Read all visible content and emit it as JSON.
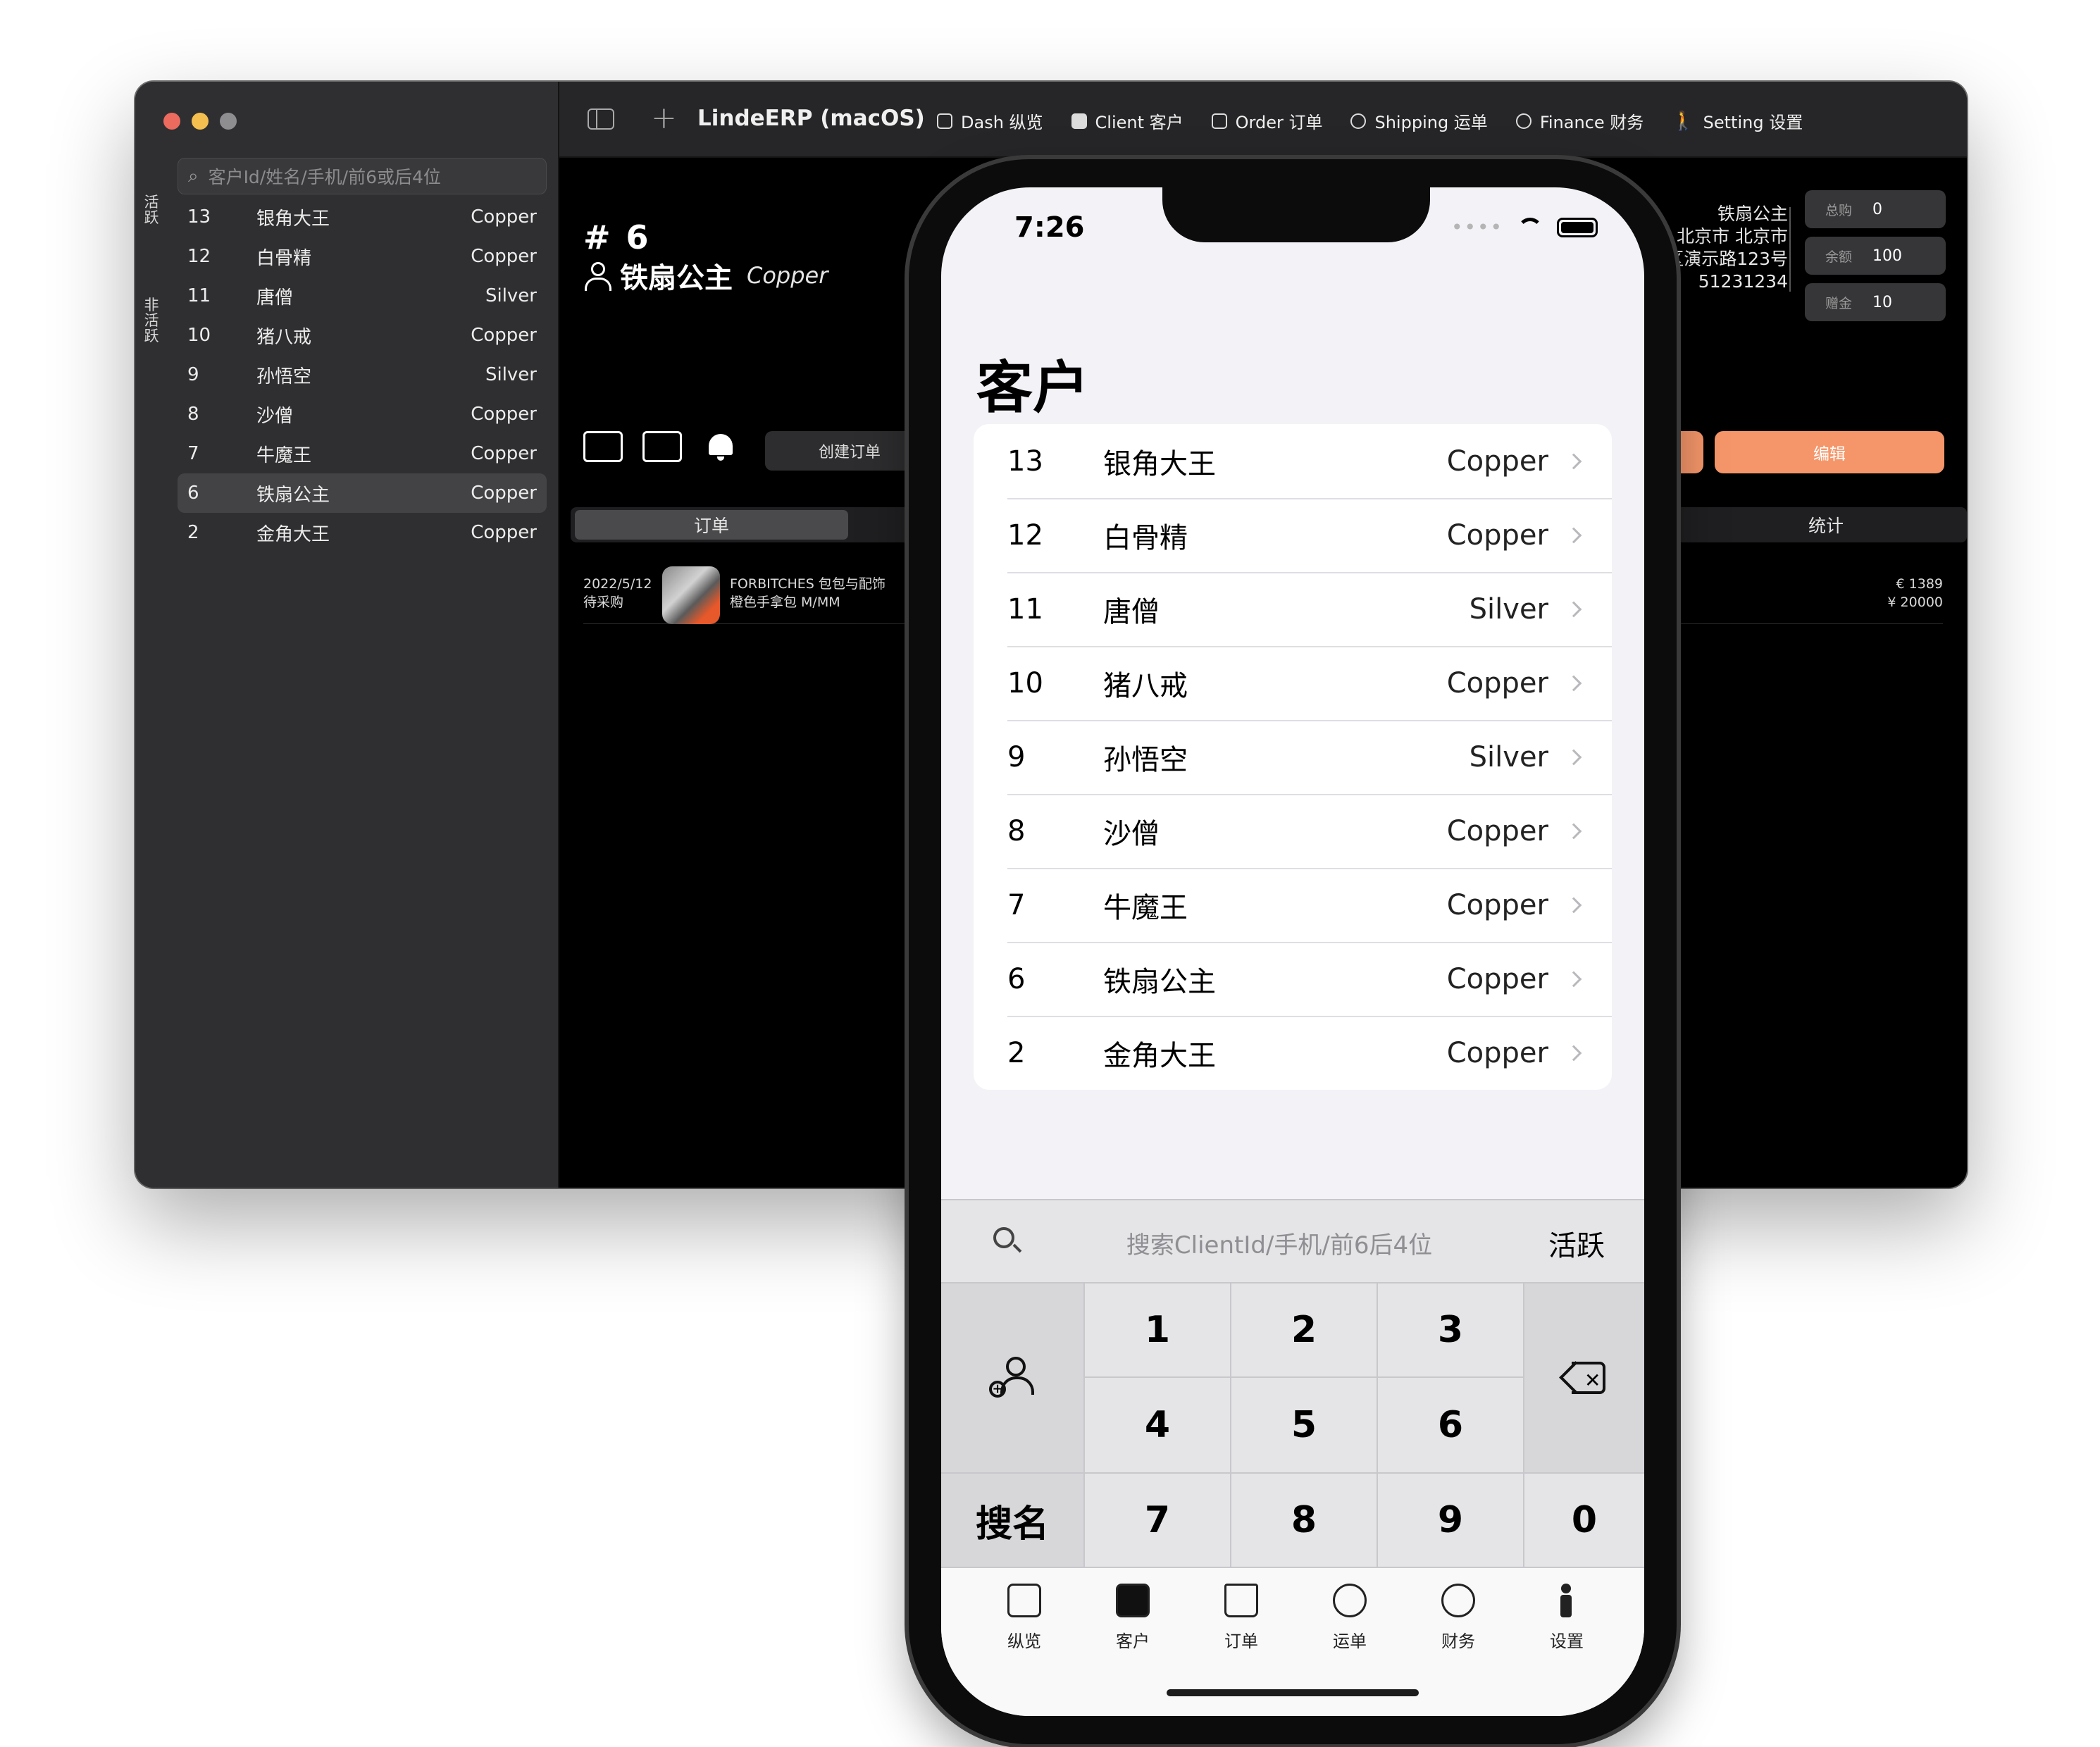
{
  "mac": {
    "title": "LindeERP (macOS)",
    "nav": [
      {
        "label": "Dash 纵览",
        "icon": "dashboard-icon"
      },
      {
        "label": "Client 客户",
        "icon": "client-card-icon"
      },
      {
        "label": "Order 订单",
        "icon": "bag-icon"
      },
      {
        "label": "Shipping 运单",
        "icon": "globe-icon"
      },
      {
        "label": "Finance 财务",
        "icon": "dollar-icon"
      },
      {
        "label": "Setting 设置",
        "icon": "person-standing-icon"
      }
    ],
    "search_placeholder": "客户Id/姓名/手机/前6或后4位",
    "label_active": "活跃",
    "label_inactive": "非活跃",
    "clients": [
      {
        "id": "13",
        "name": "银角大王",
        "tier": "Copper"
      },
      {
        "id": "12",
        "name": "白骨精",
        "tier": "Copper"
      },
      {
        "id": "11",
        "name": "唐僧",
        "tier": "Silver"
      },
      {
        "id": "10",
        "name": "猪八戒",
        "tier": "Copper"
      },
      {
        "id": "9",
        "name": "孙悟空",
        "tier": "Silver"
      },
      {
        "id": "8",
        "name": "沙僧",
        "tier": "Copper"
      },
      {
        "id": "7",
        "name": "牛魔王",
        "tier": "Copper"
      },
      {
        "id": "6",
        "name": "铁扇公主",
        "tier": "Copper",
        "selected": true
      },
      {
        "id": "2",
        "name": "金角大王",
        "tier": "Copper"
      }
    ],
    "detail": {
      "id": "# 6",
      "name": "铁扇公主",
      "tier": "Copper",
      "address_lines": [
        "铁扇公主",
        "北京市 北京市",
        "区演示路123号",
        "51231234"
      ],
      "stats": [
        {
          "key": "总购",
          "value": "0"
        },
        {
          "key": "余额",
          "value": "100"
        },
        {
          "key": "赠金",
          "value": "10"
        }
      ],
      "create_order": "创建订单",
      "edit": "编辑",
      "tab_orders": "订单",
      "tab_stats": "统计",
      "order": {
        "date": "2022/5/12",
        "status": "待采购",
        "title": "FORBITCHES 包包与配饰",
        "subtitle": "橙色手拿包 M/MM",
        "amount_eur": "€ 1389",
        "amount_cny": "¥ 20000"
      }
    }
  },
  "phone": {
    "time": "7:26",
    "title": "客户",
    "clients": [
      {
        "id": "13",
        "name": "银角大王",
        "tier": "Copper"
      },
      {
        "id": "12",
        "name": "白骨精",
        "tier": "Copper"
      },
      {
        "id": "11",
        "name": "唐僧",
        "tier": "Silver"
      },
      {
        "id": "10",
        "name": "猪八戒",
        "tier": "Copper"
      },
      {
        "id": "9",
        "name": "孙悟空",
        "tier": "Silver"
      },
      {
        "id": "8",
        "name": "沙僧",
        "tier": "Copper"
      },
      {
        "id": "7",
        "name": "牛魔王",
        "tier": "Copper"
      },
      {
        "id": "6",
        "name": "铁扇公主",
        "tier": "Copper"
      },
      {
        "id": "2",
        "name": "金角大王",
        "tier": "Copper"
      }
    ],
    "search_placeholder": "搜索ClientId/手机/前6后4位",
    "active_label": "活跃",
    "keys": [
      "1",
      "2",
      "3",
      "4",
      "5",
      "6",
      "7",
      "8",
      "9",
      "0"
    ],
    "name_search": "搜名",
    "tabs": [
      {
        "label": "纵览",
        "icon": "dashboard-icon"
      },
      {
        "label": "客户",
        "icon": "client-card-icon"
      },
      {
        "label": "订单",
        "icon": "bag-icon"
      },
      {
        "label": "运单",
        "icon": "globe-icon"
      },
      {
        "label": "财务",
        "icon": "dollar-icon"
      },
      {
        "label": "设置",
        "icon": "person-standing-icon"
      }
    ],
    "selected_tab": "客户"
  },
  "colors": {
    "accent_orange": "#f5966a",
    "mac_bg": "#1e1e1e",
    "ios_bg": "#f2f2f7"
  }
}
